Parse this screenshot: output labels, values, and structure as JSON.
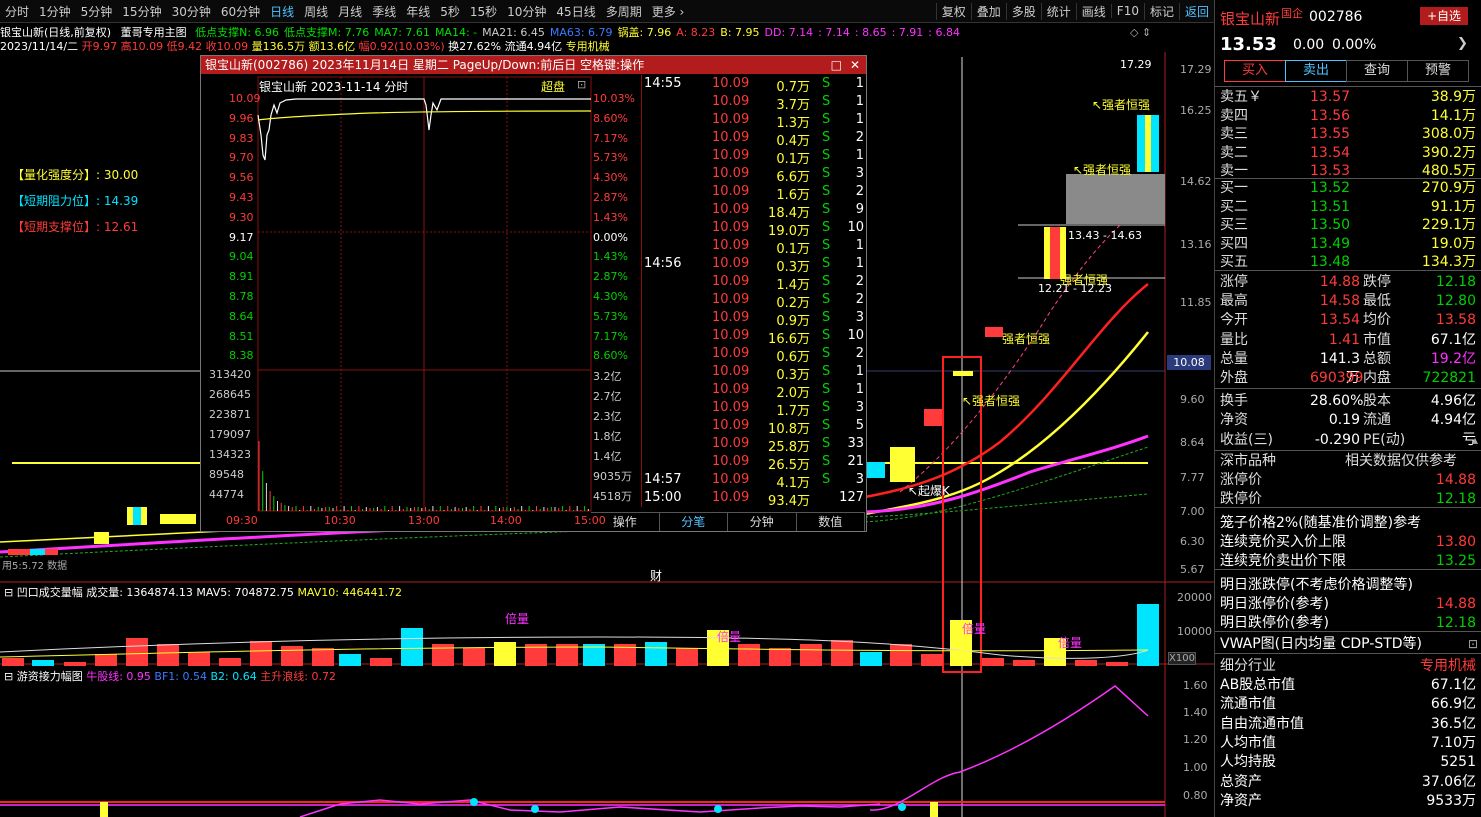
{
  "toolbar": {
    "periods": [
      "分时",
      "1分钟",
      "5分钟",
      "15分钟",
      "30分钟",
      "60分钟",
      "日线",
      "周线",
      "月线",
      "季线",
      "年线",
      "5秒",
      "15秒",
      "10分钟",
      "45日线",
      "多周期",
      "更多 ›"
    ],
    "active": "日线",
    "right": [
      "复权",
      "叠加",
      "多股",
      "统计",
      "画线",
      "F10",
      "标记",
      "返回"
    ]
  },
  "header": {
    "stock_line": "银宝山新(日线,前复权)",
    "indicator_name": "董哥专用主图",
    "ma": [
      {
        "label": "低点支撑N: 6.96",
        "color": "#00e000"
      },
      {
        "label": "低点支撑M: 7.76",
        "color": "#00e000"
      },
      {
        "label": "MA7: 7.61",
        "color": "#00e000"
      },
      {
        "label": "MA14: -",
        "color": "#00e000"
      },
      {
        "label": "MA21: 6.45",
        "color": "#cccccc"
      },
      {
        "label": "MA63: 6.79",
        "color": "#3a7bff"
      },
      {
        "label": "锅盖: 7.96",
        "color": "#ffff33"
      },
      {
        "label": "A: 8.23",
        "color": "#ff3b3b"
      },
      {
        "label": "B: 7.95",
        "color": "#ffff33"
      },
      {
        "label": "DD: 7.14",
        "color": "#ff33ff"
      },
      {
        "label": ": 7.14",
        "color": "#ff33ff"
      },
      {
        "label": ": 8.65",
        "color": "#ff33ff"
      },
      {
        "label": ": 7.91",
        "color": "#ff33ff"
      },
      {
        "label": ": 6.84",
        "color": "#ff33ff"
      }
    ],
    "date": "2023/11/14/二",
    "open": "开9.97",
    "high": "高10.09",
    "low": "低9.42",
    "close": "收10.09",
    "volume": "量136.5万",
    "amount": "额13.6亿",
    "change": "幅0.92(10.03%)",
    "turnover": "换27.62%",
    "float": "流通4.94亿",
    "industry": "专用机械"
  },
  "left_labels": {
    "quant": "【量化强度分】: 30.00",
    "resist": "【短期阻力位】: 14.39",
    "support": "【短期支撑位】: 12.61"
  },
  "price_axis": [
    "17.29",
    "16.25",
    "14.62",
    "13.16",
    "11.85",
    "10.08",
    "9.60",
    "8.64",
    "7.77",
    "7.00",
    "6.30",
    "5.67"
  ],
  "annotations": {
    "strong1": "↖强者恒强",
    "strong2": "↖强者恒强",
    "strong3": "强者恒强",
    "strong4": "↖强者恒强",
    "strong5": "强者恒强",
    "range1": "13.43 - 14.63",
    "range2": "12.21 - 12.23",
    "qibao": "↖起爆K",
    "top_price": "17.29",
    "cai": "财",
    "bottom_left": "用5:5.72 数据"
  },
  "popup": {
    "title": "银宝山新(002786) 2023年11月14日 星期二 PageUp/Down:前后日 空格键:操作",
    "chart_title": "银宝山新  2023-11-14 分时",
    "superpan": "超盘",
    "price_left": [
      "10.09",
      "9.96",
      "9.83",
      "9.70",
      "9.56",
      "9.43",
      "9.30",
      "9.17",
      "9.04",
      "8.91",
      "8.78",
      "8.64",
      "8.51",
      "8.38"
    ],
    "pct_right": [
      "10.03%",
      "8.60%",
      "7.17%",
      "5.73%",
      "4.30%",
      "2.87%",
      "1.43%",
      "0.00%",
      "1.43%",
      "2.87%",
      "4.30%",
      "5.73%",
      "7.17%",
      "8.60%"
    ],
    "vol_left": [
      "313420",
      "268645",
      "223871",
      "179097",
      "134323",
      "89548",
      "44774"
    ],
    "vol_right": [
      "3.2亿",
      "2.7亿",
      "2.3亿",
      "1.8亿",
      "1.4亿",
      "9035万",
      "4518万"
    ],
    "time_axis": [
      "09:30",
      "10:30",
      "13:00",
      "14:00",
      "15:00"
    ],
    "ticks": [
      {
        "t": "14:55",
        "p": "10.09",
        "v": "0.7万",
        "s": "S",
        "n": "1"
      },
      {
        "t": "",
        "p": "10.09",
        "v": "3.7万",
        "s": "S",
        "n": "1"
      },
      {
        "t": "",
        "p": "10.09",
        "v": "1.3万",
        "s": "S",
        "n": "1"
      },
      {
        "t": "",
        "p": "10.09",
        "v": "0.4万",
        "s": "S",
        "n": "2"
      },
      {
        "t": "",
        "p": "10.09",
        "v": "0.1万",
        "s": "S",
        "n": "1"
      },
      {
        "t": "",
        "p": "10.09",
        "v": "6.6万",
        "s": "S",
        "n": "3"
      },
      {
        "t": "",
        "p": "10.09",
        "v": "1.6万",
        "s": "S",
        "n": "2"
      },
      {
        "t": "",
        "p": "10.09",
        "v": "18.4万",
        "s": "S",
        "n": "9"
      },
      {
        "t": "",
        "p": "10.09",
        "v": "19.0万",
        "s": "S",
        "n": "10"
      },
      {
        "t": "",
        "p": "10.09",
        "v": "0.1万",
        "s": "S",
        "n": "1"
      },
      {
        "t": "14:56",
        "p": "10.09",
        "v": "0.3万",
        "s": "S",
        "n": "1"
      },
      {
        "t": "",
        "p": "10.09",
        "v": "1.4万",
        "s": "S",
        "n": "2"
      },
      {
        "t": "",
        "p": "10.09",
        "v": "0.2万",
        "s": "S",
        "n": "2"
      },
      {
        "t": "",
        "p": "10.09",
        "v": "0.9万",
        "s": "S",
        "n": "3"
      },
      {
        "t": "",
        "p": "10.09",
        "v": "16.6万",
        "s": "S",
        "n": "10"
      },
      {
        "t": "",
        "p": "10.09",
        "v": "0.6万",
        "s": "S",
        "n": "2"
      },
      {
        "t": "",
        "p": "10.09",
        "v": "0.3万",
        "s": "S",
        "n": "1"
      },
      {
        "t": "",
        "p": "10.09",
        "v": "2.0万",
        "s": "S",
        "n": "1"
      },
      {
        "t": "",
        "p": "10.09",
        "v": "1.7万",
        "s": "S",
        "n": "3"
      },
      {
        "t": "",
        "p": "10.09",
        "v": "10.8万",
        "s": "S",
        "n": "5"
      },
      {
        "t": "",
        "p": "10.09",
        "v": "25.8万",
        "s": "S",
        "n": "33"
      },
      {
        "t": "",
        "p": "10.09",
        "v": "26.5万",
        "s": "S",
        "n": "21"
      },
      {
        "t": "14:57",
        "p": "10.09",
        "v": "4.1万",
        "s": "S",
        "n": "3"
      },
      {
        "t": "15:00",
        "p": "10.09",
        "v": "93.4万",
        "s": "",
        "n": "127"
      }
    ],
    "tabs": [
      "操作",
      "分笔",
      "分钟",
      "数值"
    ]
  },
  "vol_panel": {
    "title": "凹口成交量幅",
    "vol": "成交量: 1364874.13",
    "mav5": "MAV5: 704872.75",
    "mav10": "MAV10: 446441.72",
    "axis": [
      "20000",
      "10000"
    ],
    "unit": "X100",
    "beiliang": "倍量"
  },
  "ind_panel": {
    "title": "游资接力幅图",
    "niu": "牛股线: 0.95",
    "b1": "BF1: 0.54",
    "b2": "B2: 0.64",
    "zs": "主升浪线: 0.72",
    "axis": [
      "1.60",
      "1.40",
      "1.20",
      "1.00",
      "0.80"
    ]
  },
  "right_panel": {
    "name": "银宝山新",
    "guoqi": "国企",
    "code": "002786",
    "add_btn": "+自选",
    "price": "13.53",
    "chg": "0.00",
    "pct": "0.00%",
    "btns": [
      "买入",
      "卖出",
      "查询",
      "预警"
    ],
    "asks": [
      {
        "l": "卖五￥",
        "p": "13.57",
        "v": "38.9万"
      },
      {
        "l": "卖四",
        "p": "13.56",
        "v": "14.1万"
      },
      {
        "l": "卖三",
        "p": "13.55",
        "v": "308.0万"
      },
      {
        "l": "卖二",
        "p": "13.54",
        "v": "390.2万"
      },
      {
        "l": "卖一",
        "p": "13.53",
        "v": "480.5万"
      }
    ],
    "bids": [
      {
        "l": "买一",
        "p": "13.52",
        "v": "270.9万"
      },
      {
        "l": "买二",
        "p": "13.51",
        "v": "91.1万"
      },
      {
        "l": "买三",
        "p": "13.50",
        "v": "229.1万"
      },
      {
        "l": "买四",
        "p": "13.49",
        "v": "19.0万"
      },
      {
        "l": "买五",
        "p": "13.48",
        "v": "134.3万"
      }
    ],
    "stats": [
      {
        "l1": "涨停",
        "v1": "14.88",
        "l2": "跌停",
        "v2": "12.18"
      },
      {
        "l1": "最高",
        "v1": "14.58",
        "l2": "最低",
        "v2": "12.80"
      },
      {
        "l1": "今开",
        "v1": "13.54",
        "l2": "均价",
        "v2": "13.58"
      },
      {
        "l1": "量比",
        "v1": "1.41",
        "l2": "市值",
        "v2": "67.1亿"
      },
      {
        "l1": "总量",
        "v1": "141.3万",
        "l2": "总额",
        "v2": "19.2亿"
      },
      {
        "l1": "外盘",
        "v1": "690399",
        "l2": "内盘",
        "v2": "722821"
      },
      {
        "l1": "换手",
        "v1": "28.60%",
        "l2": "股本",
        "v2": "4.96亿"
      },
      {
        "l1": "净资",
        "v1": "0.19",
        "l2": "流通",
        "v2": "4.94亿"
      },
      {
        "l1": "收益(三)",
        "v1": "-0.290",
        "l2": "PE(动)",
        "v2": "亏"
      }
    ],
    "market_kind": "深市品种",
    "market_note": "相关数据仅供参考",
    "limit_up": "涨停价",
    "limit_up_v": "14.88",
    "limit_dn": "跌停价",
    "limit_dn_v": "12.18",
    "cage": "笼子价格2%(随基准价调整)参考",
    "cage_buy": "连续竞价买入价上限",
    "cage_buy_v": "13.80",
    "cage_sell": "连续竞价卖出价下限",
    "cage_sell_v": "13.25",
    "tomorrow": "明日涨跌停(不考虑价格调整等)",
    "tm_up": "明日涨停价(参考)",
    "tm_up_v": "14.88",
    "tm_dn": "明日跌停价(参考)",
    "tm_dn_v": "12.18",
    "vwap": "VWAP图(日内均量 CDP-STD等)",
    "industry_l": "细分行业",
    "industry_v": "专用机械",
    "fund": [
      {
        "l": "AB股总市值",
        "v": "67.1亿"
      },
      {
        "l": "流通市值",
        "v": "66.9亿"
      },
      {
        "l": "自由流通市值",
        "v": "36.5亿"
      },
      {
        "l": "人均市值",
        "v": "7.10万"
      },
      {
        "l": "人均持股",
        "v": "5251"
      },
      {
        "l": "总资产",
        "v": "37.06亿"
      },
      {
        "l": "净资产",
        "v": "9533万"
      }
    ]
  }
}
